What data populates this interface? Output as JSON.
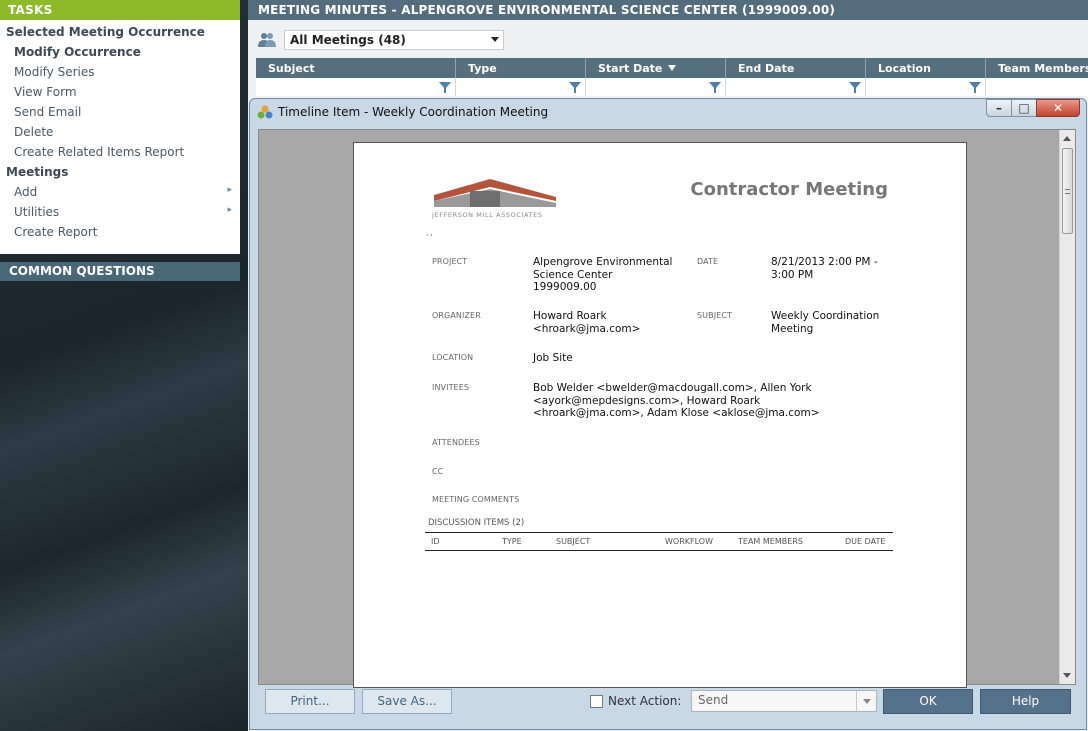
{
  "sidebar": {
    "tasks_header": "TASKS",
    "sections": [
      {
        "title": "Selected Meeting Occurrence",
        "items": [
          {
            "label": "Modify Occurrence"
          },
          {
            "label": "Modify Series"
          },
          {
            "label": "View Form"
          },
          {
            "label": "Send Email"
          },
          {
            "label": "Delete"
          },
          {
            "label": "Create Related Items Report"
          }
        ]
      },
      {
        "title": "Meetings",
        "items": [
          {
            "label": "Add",
            "arrow": "▸"
          },
          {
            "label": "Utilities",
            "arrow": "▸"
          },
          {
            "label": "Create Report"
          }
        ]
      }
    ],
    "common_questions": "COMMON QUESTIONS"
  },
  "header": {
    "title": "MEETING MINUTES - ALPENGROVE ENVIRONMENTAL SCIENCE CENTER (1999009.00)",
    "meetings_filter": "All Meetings (48)"
  },
  "grid": {
    "columns": [
      "Subject",
      "Type",
      "Start Date",
      "End Date",
      "Location",
      "Team Members"
    ]
  },
  "dialog": {
    "title": "Timeline Item - Weekly Coordination Meeting",
    "window_buttons": {
      "minimize": "–",
      "maximize": "□",
      "close": "✕"
    },
    "document": {
      "logo_text": "JEFFERSON MILL ASSOCIATES",
      "title": "Contractor Meeting",
      "stray_text": ", ,",
      "fields": {
        "project_label": "PROJECT",
        "project_value": "Alpengrove Environmental Science Center 1999009.00",
        "date_label": "DATE",
        "date_value": "8/21/2013 2:00 PM - 3:00 PM",
        "organizer_label": "ORGANIZER",
        "organizer_value": "Howard Roark <hroark@jma.com>",
        "subject_label": "SUBJECT",
        "subject_value": "Weekly Coordination Meeting",
        "location_label": "LOCATION",
        "location_value": "Job Site",
        "invitees_label": "INVITEES",
        "invitees_value": "Bob Welder <bwelder@macdougall.com>, Allen York <ayork@mepdesigns.com>, Howard Roark <hroark@jma.com>, Adam Klose <aklose@jma.com>",
        "attendees_label": "ATTENDEES",
        "cc_label": "CC",
        "comments_label": "MEETING COMMENTS"
      },
      "discussion_title": "DISCUSSION ITEMS (2)",
      "discussion_columns": [
        "ID",
        "TYPE",
        "SUBJECT",
        "WORKFLOW",
        "TEAM MEMBERS",
        "DUE DATE"
      ]
    },
    "footer": {
      "print": "Print...",
      "save_as": "Save As...",
      "next_action_label": "Next Action:",
      "next_action_checked": false,
      "next_action_value": "Send",
      "ok": "OK",
      "help": "Help"
    }
  }
}
